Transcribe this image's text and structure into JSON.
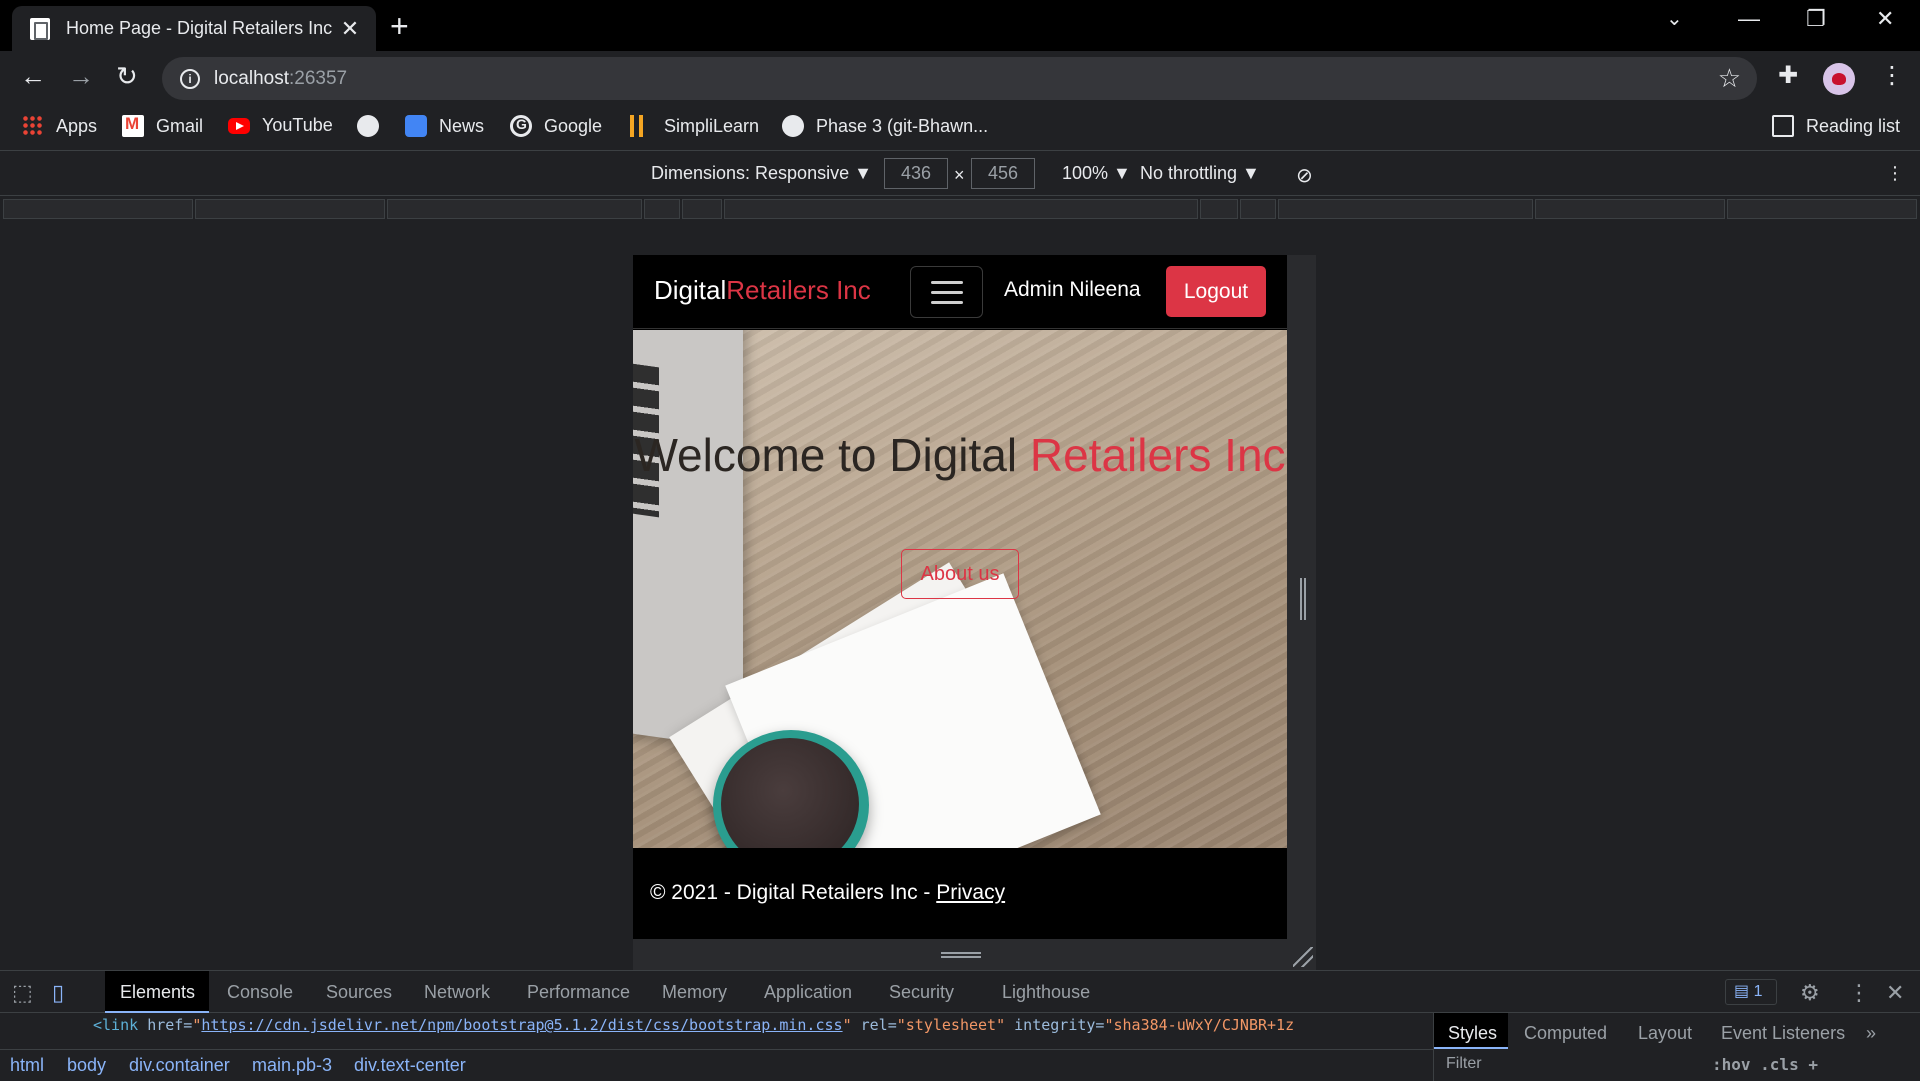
{
  "browser": {
    "tab_title": "Home Page - Digital Retailers Inc",
    "new_tab": "+",
    "url_host": "localhost",
    "url_port": ":26357",
    "bookmarks": [
      "Apps",
      "Gmail",
      "YouTube",
      "",
      "News",
      "Google",
      "SimpliLearn",
      "Phase 3 (git-Bhawn..."
    ],
    "reading_list": "Reading list"
  },
  "device_toolbar": {
    "dimensions": "Dimensions: Responsive ▼",
    "width": "436",
    "times": "×",
    "height": "456",
    "zoom": "100% ▼",
    "throttling": "No throttling ▼"
  },
  "site": {
    "brand_white": "Digital",
    "brand_red": "Retailers Inc",
    "admin_name": "Admin Nileena",
    "logout": "Logout",
    "hero_title_dark": "Welcome to Digital ",
    "hero_title_red": "Retailers Inc",
    "about_button": "About us",
    "footer_text": "© 2021 - Digital Retailers Inc - ",
    "footer_link": "Privacy"
  },
  "devtools": {
    "tabs": [
      "Elements",
      "Console",
      "Sources",
      "Network",
      "Performance",
      "Memory",
      "Application",
      "Security",
      "Lighthouse"
    ],
    "message_count": "1",
    "code": {
      "open": "<link ",
      "href_attr": "href=",
      "href_val": "https://cdn.jsdelivr.net/npm/bootstrap@5.1.2/dist/css/bootstrap.min.css",
      "rel_attr": " rel=",
      "rel_val": "\"stylesheet\"",
      "integrity_attr": " integrity=",
      "integrity_val": "\"sha384-uWxY/CJNBR+1z"
    },
    "side_tabs": [
      "Styles",
      "Computed",
      "Layout",
      "Event Listeners",
      "»"
    ],
    "filter_placeholder": "Filter",
    "hov_cls": ":hov .cls +",
    "breadcrumbs": [
      "html",
      "body",
      "div.container",
      "main.pb-3",
      "div.text-center"
    ]
  }
}
